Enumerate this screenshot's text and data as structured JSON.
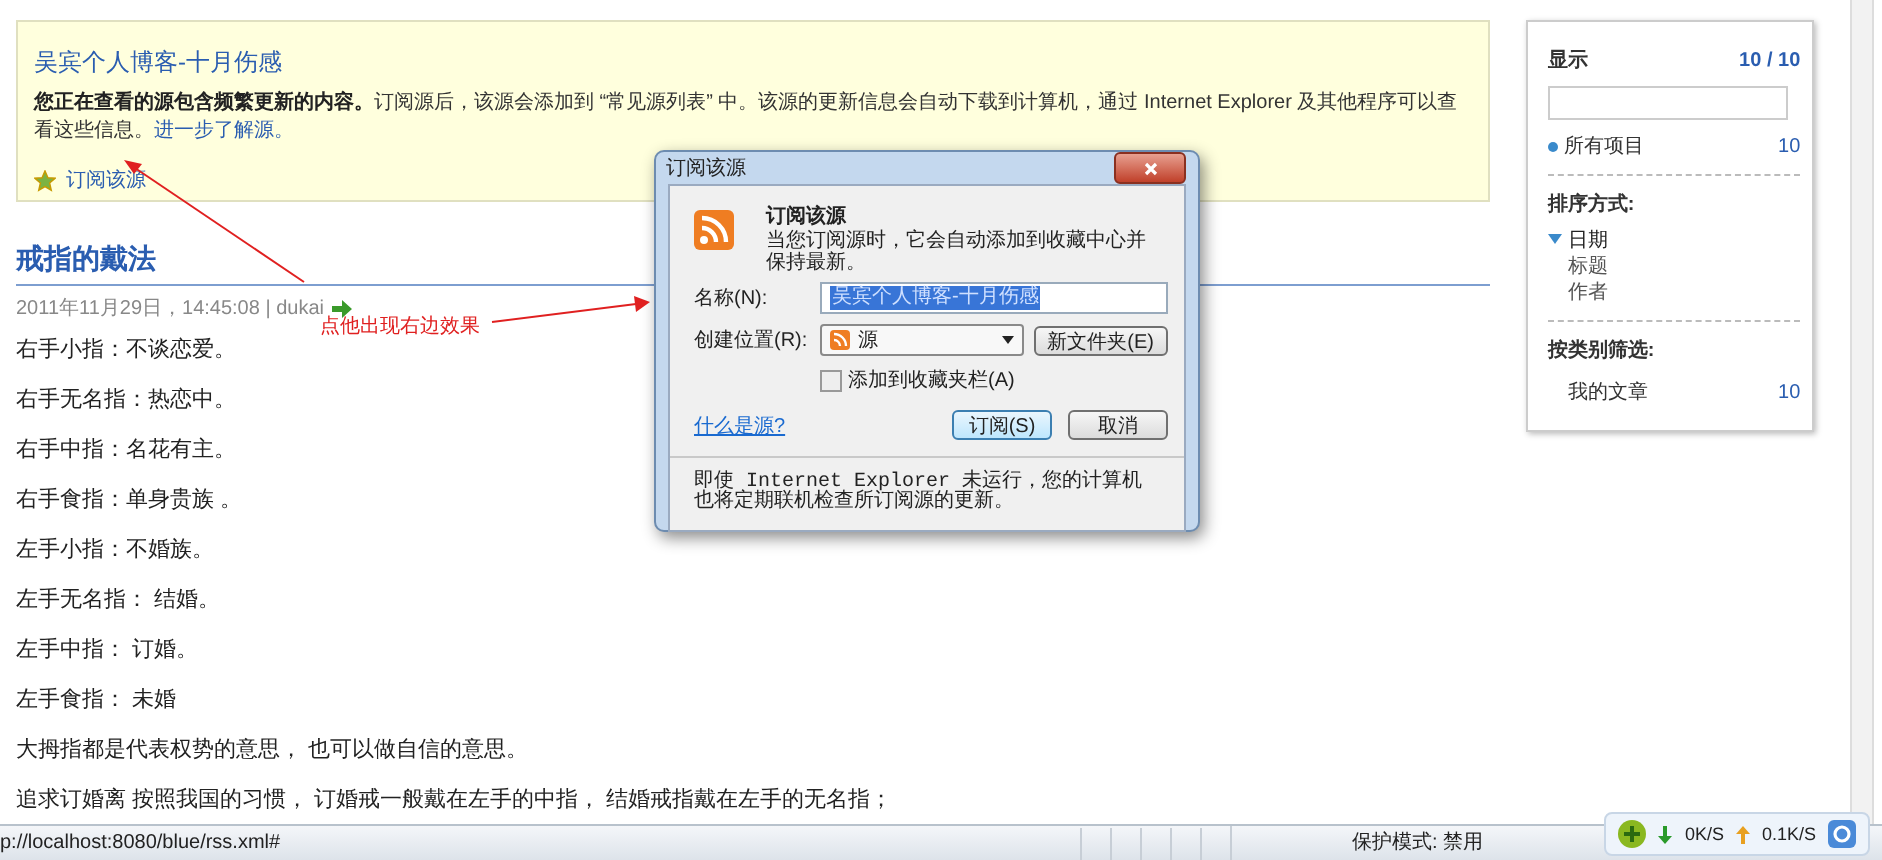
{
  "banner": {
    "title": "吴宾个人博客-十月伤感",
    "lead": "您正在查看的源包含频繁更新的内容。",
    "body": "订阅源后，该源会添加到 “常见源列表” 中。该源的更新信息会自动下载到计算机，通过 Internet Explorer 及其他程序可以查看这些信息。",
    "link": "进一步了解源。",
    "subscribe_link": "订阅该源"
  },
  "article": {
    "title": "戒指的戴法",
    "meta": "2011年11月29日，14:45:08 | dukai",
    "paragraphs": [
      "右手小指：不谈恋爱。",
      "右手无名指：热恋中。",
      "右手中指：名花有主。",
      "右手食指：单身贵族 。",
      "左手小指：不婚族。",
      "左手无名指： 结婚。",
      "左手中指： 订婚。",
      "左手食指： 未婚",
      "大拇指都是代表权势的意思， 也可以做自信的意思。",
      "追求订婚离 按照我国的习惯， 订婚戒一般戴在左手的中指， 结婚戒指戴在左手的无名指；"
    ]
  },
  "annotation": {
    "text": "点他出现右边效果"
  },
  "sidebar": {
    "heading": "显示",
    "count": "10 / 10",
    "all_items": {
      "label": "所有项目",
      "count": "10"
    },
    "sort_heading": "排序方式:",
    "sort_options": [
      {
        "label": "日期",
        "selected": true
      },
      {
        "label": "标题",
        "selected": false
      },
      {
        "label": "作者",
        "selected": false
      }
    ],
    "category_heading": "按类别筛选:",
    "categories": [
      {
        "label": "我的文章",
        "count": "10"
      }
    ]
  },
  "dialog": {
    "title": "订阅该源",
    "heading": "订阅该源",
    "description": "当您订阅源时，它会自动添加到收藏中心并保持最新。",
    "name_label": "名称(N):",
    "name_value": "吴宾个人博客-十月伤感",
    "location_label": "创建位置(R):",
    "location_value": "源",
    "new_folder_button": "新文件夹(E)",
    "favorites_bar": {
      "label": "添加到收藏夹栏(A)",
      "checked": false
    },
    "help_link": "什么是源?",
    "buttons": [
      {
        "label": "订阅(S)",
        "default": true
      },
      {
        "label": "取消",
        "default": false
      }
    ],
    "footer": "即使 Internet Explorer 未运行，您的计算机也将定期联机检查所订阅源的更新。"
  },
  "status_bar": {
    "url": "p://localhost:8080/blue/rss.xml#",
    "protected_mode": "保护模式: 禁用",
    "download_speed": "0K/S",
    "upload_speed": "0.1K/S"
  }
}
